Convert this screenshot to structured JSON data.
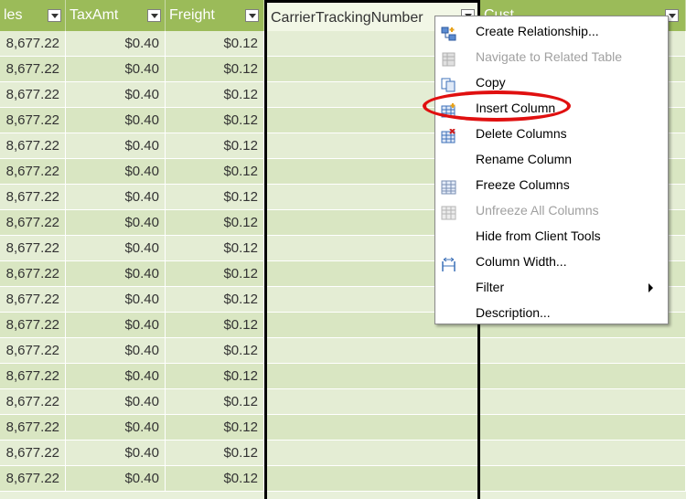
{
  "grid": {
    "headers": [
      {
        "label": "les",
        "name": "header-sales"
      },
      {
        "label": "TaxAmt",
        "name": "header-taxamt"
      },
      {
        "label": "Freight",
        "name": "header-freight"
      },
      {
        "label": "CarrierTrackingNumber",
        "name": "header-carriertrackingnumber"
      },
      {
        "label": "Cust",
        "name": "header-next-column"
      }
    ],
    "rows": [
      [
        "8,677.22",
        "$0.40",
        "$0.12"
      ],
      [
        "8,677.22",
        "$0.40",
        "$0.12"
      ],
      [
        "8,677.22",
        "$0.40",
        "$0.12"
      ],
      [
        "8,677.22",
        "$0.40",
        "$0.12"
      ],
      [
        "8,677.22",
        "$0.40",
        "$0.12"
      ],
      [
        "8,677.22",
        "$0.40",
        "$0.12"
      ],
      [
        "8,677.22",
        "$0.40",
        "$0.12"
      ],
      [
        "8,677.22",
        "$0.40",
        "$0.12"
      ],
      [
        "8,677.22",
        "$0.40",
        "$0.12"
      ],
      [
        "8,677.22",
        "$0.40",
        "$0.12"
      ],
      [
        "8,677.22",
        "$0.40",
        "$0.12"
      ],
      [
        "8,677.22",
        "$0.40",
        "$0.12"
      ],
      [
        "8,677.22",
        "$0.40",
        "$0.12"
      ],
      [
        "8,677.22",
        "$0.40",
        "$0.12"
      ],
      [
        "8,677.22",
        "$0.40",
        "$0.12"
      ],
      [
        "8,677.22",
        "$0.40",
        "$0.12"
      ],
      [
        "8,677.22",
        "$0.40",
        "$0.12"
      ],
      [
        "8,677.22",
        "$0.40",
        "$0.12"
      ]
    ]
  },
  "context_menu": {
    "items": [
      {
        "label": "Create Relationship...",
        "icon": "create-relationship-icon",
        "enabled": true
      },
      {
        "label": "Navigate to Related Table",
        "icon": "navigate-related-table-icon",
        "enabled": false
      },
      {
        "label": "Copy",
        "icon": "copy-icon",
        "enabled": true
      },
      {
        "label": "Insert Column",
        "icon": "insert-column-icon",
        "enabled": true
      },
      {
        "label": "Delete Columns",
        "icon": "delete-columns-icon",
        "enabled": true
      },
      {
        "label": "Rename Column",
        "icon": "",
        "enabled": true
      },
      {
        "label": "Freeze Columns",
        "icon": "freeze-columns-icon",
        "enabled": true
      },
      {
        "label": "Unfreeze All Columns",
        "icon": "unfreeze-columns-icon",
        "enabled": false
      },
      {
        "label": "Hide from Client Tools",
        "icon": "",
        "enabled": true
      },
      {
        "label": "Column Width...",
        "icon": "column-width-icon",
        "enabled": true
      },
      {
        "label": "Filter",
        "icon": "",
        "enabled": true,
        "submenu": true
      },
      {
        "label": "Description...",
        "icon": "",
        "enabled": true
      }
    ]
  },
  "highlight": {
    "target": "Insert Column",
    "color": "#e01010"
  },
  "colors": {
    "header": "#9bbb59",
    "row_odd": "#e4edd4",
    "row_even": "#d9e6c2"
  }
}
